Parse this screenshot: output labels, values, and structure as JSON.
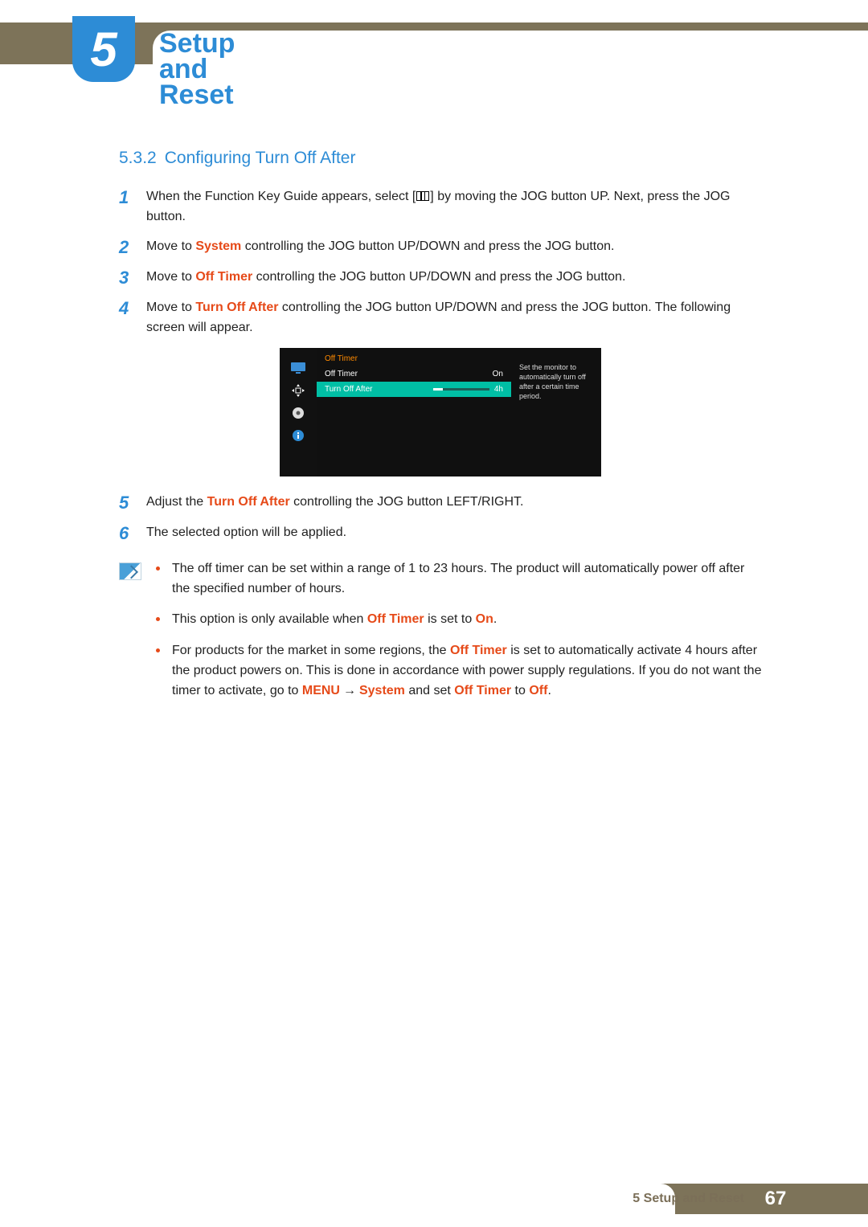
{
  "chapter": {
    "number": "5",
    "title": "Setup and Reset"
  },
  "section": {
    "number": "5.3.2",
    "title": "Configuring Turn Off After"
  },
  "steps": {
    "s1": {
      "num": "1",
      "pre": "When the Function Key Guide appears, select [",
      "post": "] by moving the JOG button UP. Next, press the JOG button."
    },
    "s2": {
      "num": "2",
      "pre": "Move to ",
      "hl": "System",
      "post": " controlling the JOG button UP/DOWN and press the JOG button."
    },
    "s3": {
      "num": "3",
      "pre": "Move to ",
      "hl": "Off Timer",
      "post": " controlling the JOG button UP/DOWN and press the JOG button."
    },
    "s4": {
      "num": "4",
      "pre": "Move to ",
      "hl": "Turn Off After",
      "post": " controlling the JOG button UP/DOWN and press the JOG button. The following screen will appear."
    },
    "s5": {
      "num": "5",
      "pre": "Adjust the ",
      "hl": "Turn Off After",
      "post": " controlling the JOG button LEFT/RIGHT."
    },
    "s6": {
      "num": "6",
      "text": "The selected option will be applied."
    }
  },
  "osd": {
    "header": "Off Timer",
    "row1": {
      "label": "Off Timer",
      "value": "On"
    },
    "row2": {
      "label": "Turn Off After",
      "value": "4h"
    },
    "help": "Set the monitor to automatically turn off after a certain time period."
  },
  "notes": {
    "n1": "The off timer can be set within a range of 1 to 23 hours. The product will automatically power off after the specified number of hours.",
    "n2": {
      "pre": "This option is only available when ",
      "hl1": "Off Timer",
      "mid": " is set to ",
      "hl2": "On",
      "post": "."
    },
    "n3": {
      "pre": "For products for the market in some regions, the ",
      "hl1": "Off Timer",
      "mid1": " is set to automatically activate 4 hours after the product powers on. This is done in accordance with power supply regulations. If you do not want the timer to activate, go to ",
      "menu": "MENU",
      "arrow": "→",
      "system": "System",
      "mid2": " and set ",
      "hl2": "Off Timer",
      "mid3": " to ",
      "hl3": "Off",
      "post": "."
    }
  },
  "footer": {
    "label": "5 Setup and Reset",
    "page": "67"
  }
}
